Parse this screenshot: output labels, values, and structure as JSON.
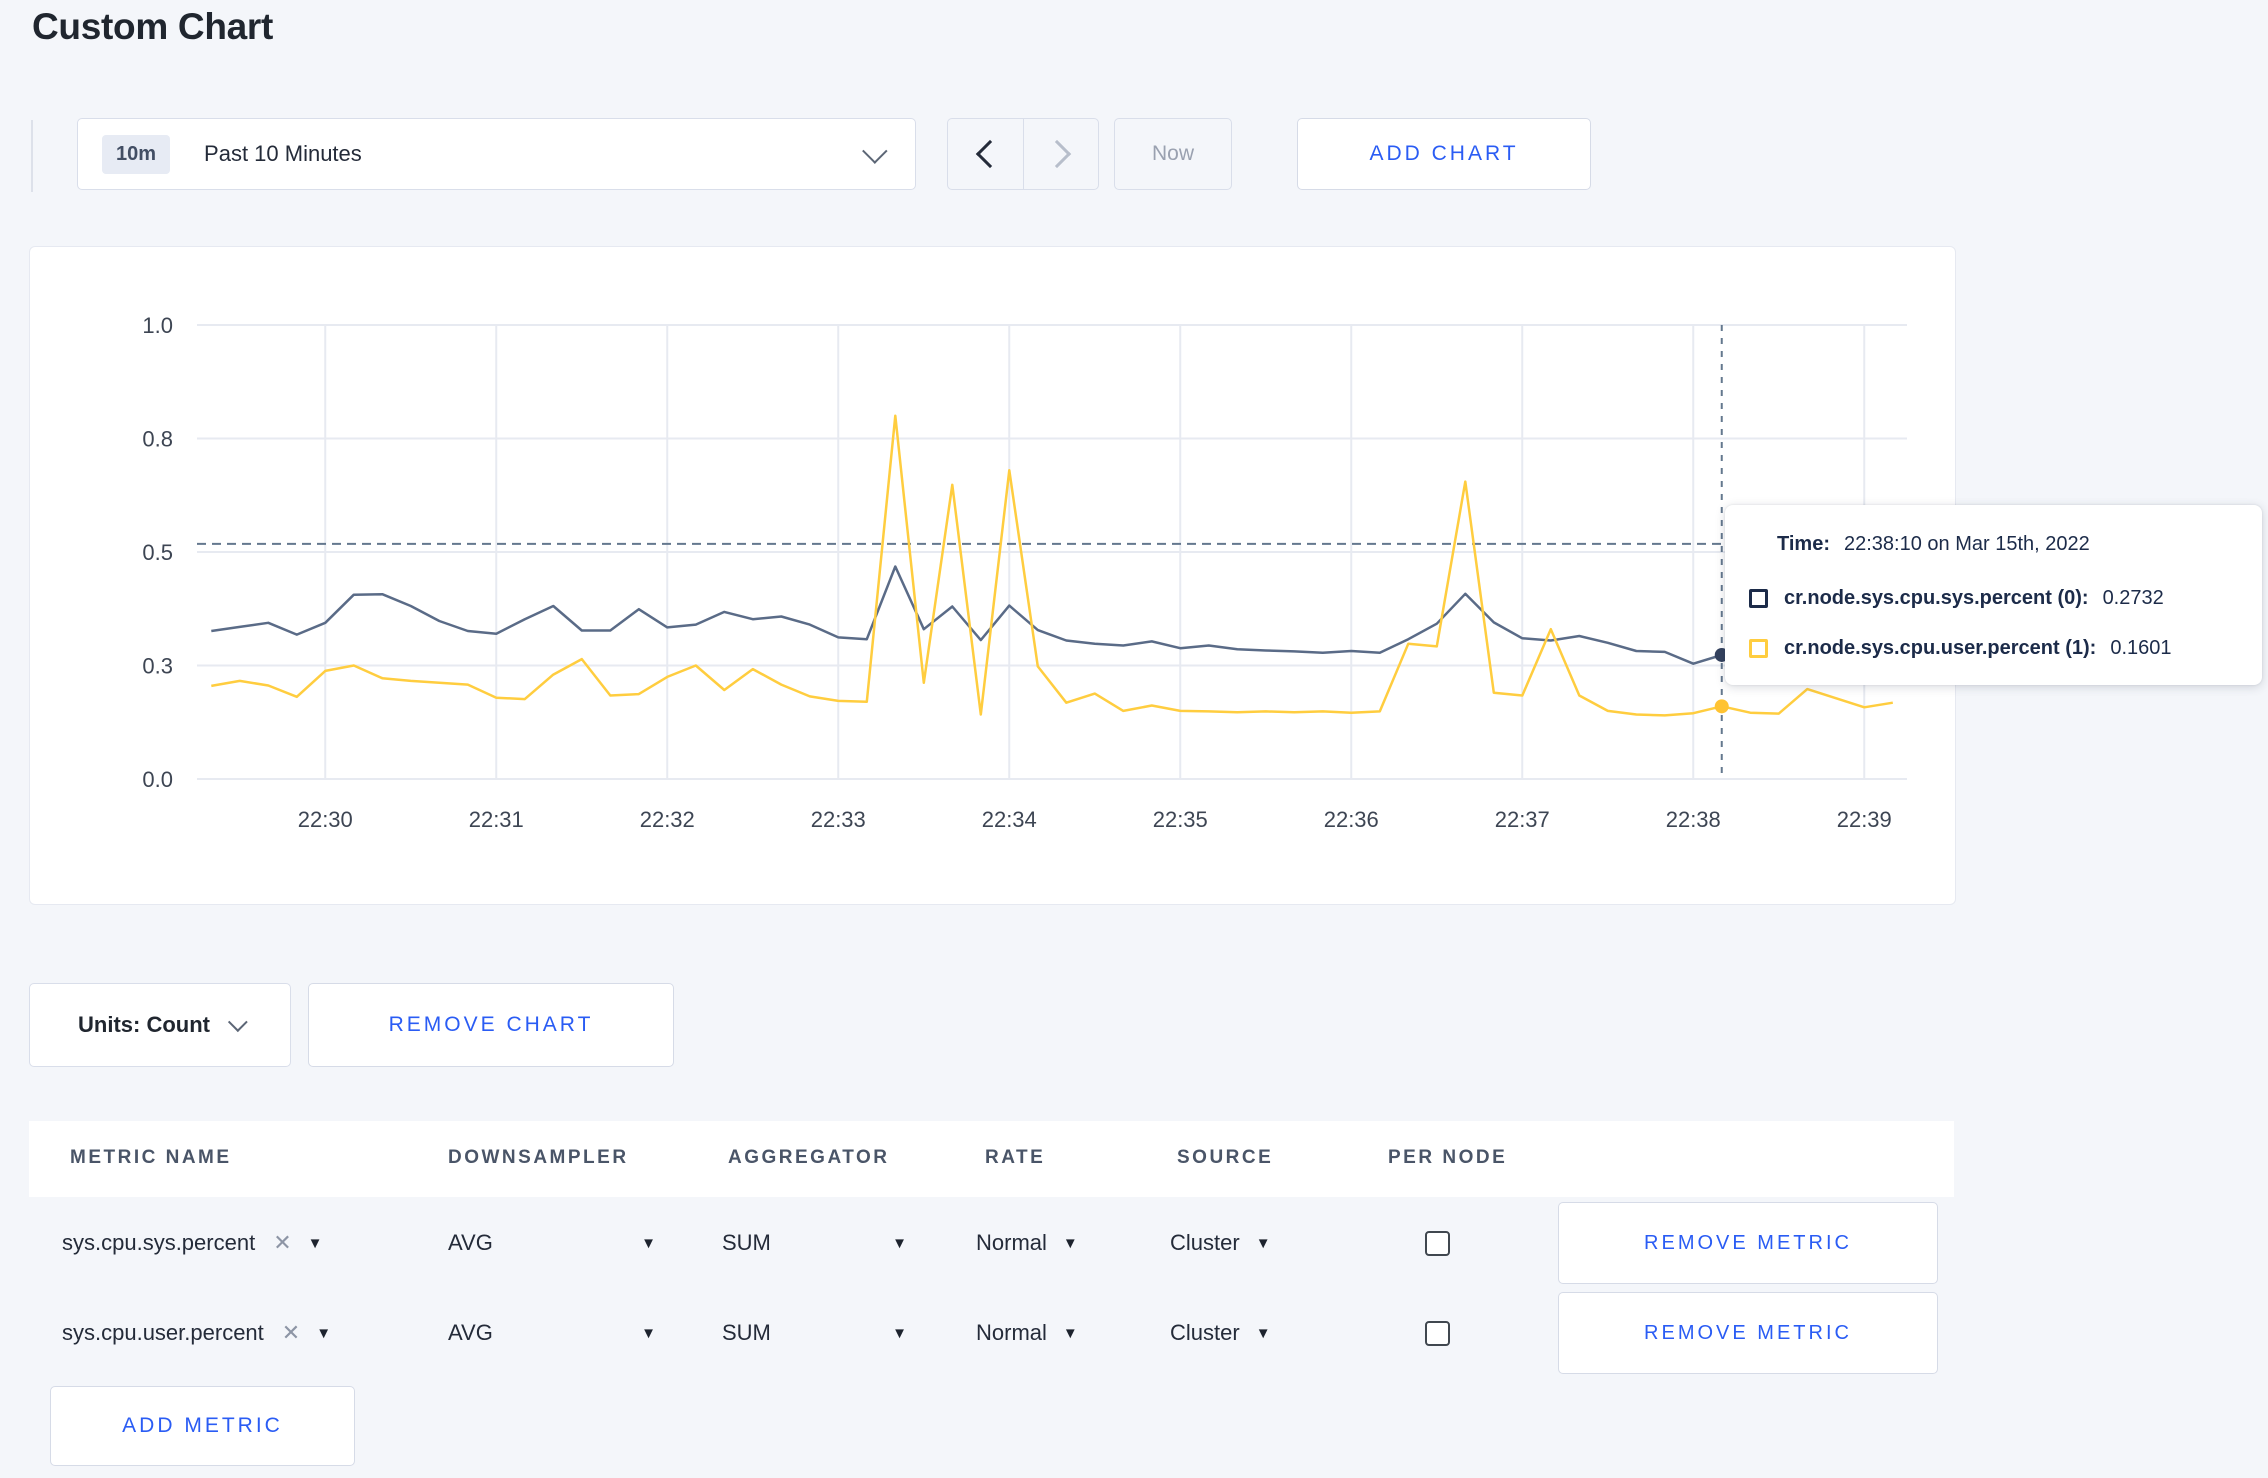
{
  "page": {
    "title": "Custom Chart"
  },
  "toolbar": {
    "time_picker": {
      "badge": "10m",
      "label": "Past 10 Minutes"
    },
    "now_label": "Now",
    "add_chart_label": "ADD CHART"
  },
  "chart_data": {
    "type": "line",
    "title": "",
    "xlabel": "",
    "ylabel": "",
    "ylim": [
      0,
      1
    ],
    "grid": true,
    "x_start": "22:29:20",
    "x_step_seconds": 10,
    "x_tick_labels": [
      "22:30",
      "22:31",
      "22:32",
      "22:33",
      "22:34",
      "22:35",
      "22:36",
      "22:37",
      "22:38",
      "22:39"
    ],
    "y_tick_labels": [
      "0.0",
      "0.3",
      "0.5",
      "0.8",
      "1.0"
    ],
    "y_tick_values": [
      0,
      0.25,
      0.5,
      0.75,
      1.0
    ],
    "series": [
      {
        "name": "cr.node.sys.cpu.sys.percent (0)",
        "color": "#5a6b87",
        "dot_color": "#33415e",
        "values": [
          0.326,
          0.335,
          0.344,
          0.318,
          0.344,
          0.406,
          0.407,
          0.381,
          0.348,
          0.326,
          0.32,
          0.352,
          0.381,
          0.327,
          0.327,
          0.374,
          0.334,
          0.34,
          0.368,
          0.352,
          0.358,
          0.34,
          0.312,
          0.308,
          0.468,
          0.33,
          0.38,
          0.306,
          0.382,
          0.328,
          0.305,
          0.298,
          0.294,
          0.303,
          0.288,
          0.294,
          0.286,
          0.283,
          0.281,
          0.278,
          0.282,
          0.278,
          0.308,
          0.342,
          0.408,
          0.345,
          0.31,
          0.305,
          0.315,
          0.3,
          0.282,
          0.28,
          0.254,
          0.2732,
          0.28,
          0.276,
          0.28,
          0.282,
          0.278,
          0.276
        ]
      },
      {
        "name": "cr.node.sys.cpu.user.percent (1)",
        "color": "#ffcd3f",
        "dot_color": "#ffc332",
        "values": [
          0.205,
          0.216,
          0.206,
          0.181,
          0.238,
          0.25,
          0.222,
          0.216,
          0.212,
          0.208,
          0.179,
          0.176,
          0.23,
          0.264,
          0.184,
          0.187,
          0.225,
          0.25,
          0.196,
          0.242,
          0.208,
          0.182,
          0.172,
          0.17,
          0.8,
          0.212,
          0.648,
          0.142,
          0.68,
          0.248,
          0.168,
          0.188,
          0.15,
          0.162,
          0.15,
          0.149,
          0.147,
          0.149,
          0.147,
          0.149,
          0.146,
          0.149,
          0.298,
          0.292,
          0.655,
          0.19,
          0.184,
          0.33,
          0.184,
          0.15,
          0.142,
          0.14,
          0.145,
          0.1601,
          0.146,
          0.144,
          0.198,
          0.178,
          0.158,
          0.168
        ]
      }
    ],
    "crosshair": {
      "index": 53,
      "time": "22:38:10",
      "value_line": 0.518,
      "dot_values": [
        0.2732,
        0.1601
      ]
    },
    "legend_position": "tooltip-only"
  },
  "tooltip": {
    "time_label": "Time:",
    "time_value": "22:38:10 on Mar 15th, 2022",
    "series": [
      {
        "label": "cr.node.sys.cpu.sys.percent (0):",
        "value": "0.2732",
        "color": "#1c2b49"
      },
      {
        "label": "cr.node.sys.cpu.user.percent (1):",
        "value": "0.1601",
        "color": "#ffcd3f"
      }
    ]
  },
  "chart_controls": {
    "units_label": "Units: Count",
    "remove_chart_label": "REMOVE CHART"
  },
  "metrics_table": {
    "headers": [
      "METRIC NAME",
      "DOWNSAMPLER",
      "AGGREGATOR",
      "RATE",
      "SOURCE",
      "PER NODE"
    ],
    "rows": [
      {
        "metric": "sys.cpu.sys.percent",
        "downsampler": "AVG",
        "aggregator": "SUM",
        "rate": "Normal",
        "source": "Cluster",
        "per_node": false,
        "remove_label": "REMOVE METRIC"
      },
      {
        "metric": "sys.cpu.user.percent",
        "downsampler": "AVG",
        "aggregator": "SUM",
        "rate": "Normal",
        "source": "Cluster",
        "per_node": false,
        "remove_label": "REMOVE METRIC"
      }
    ],
    "add_metric_label": "ADD METRIC"
  },
  "colors": {
    "accent_blue": "#2a5cf4",
    "page_bg": "#f4f6fa",
    "grid": "#e7eaf1",
    "crosshair": "#64788e"
  }
}
